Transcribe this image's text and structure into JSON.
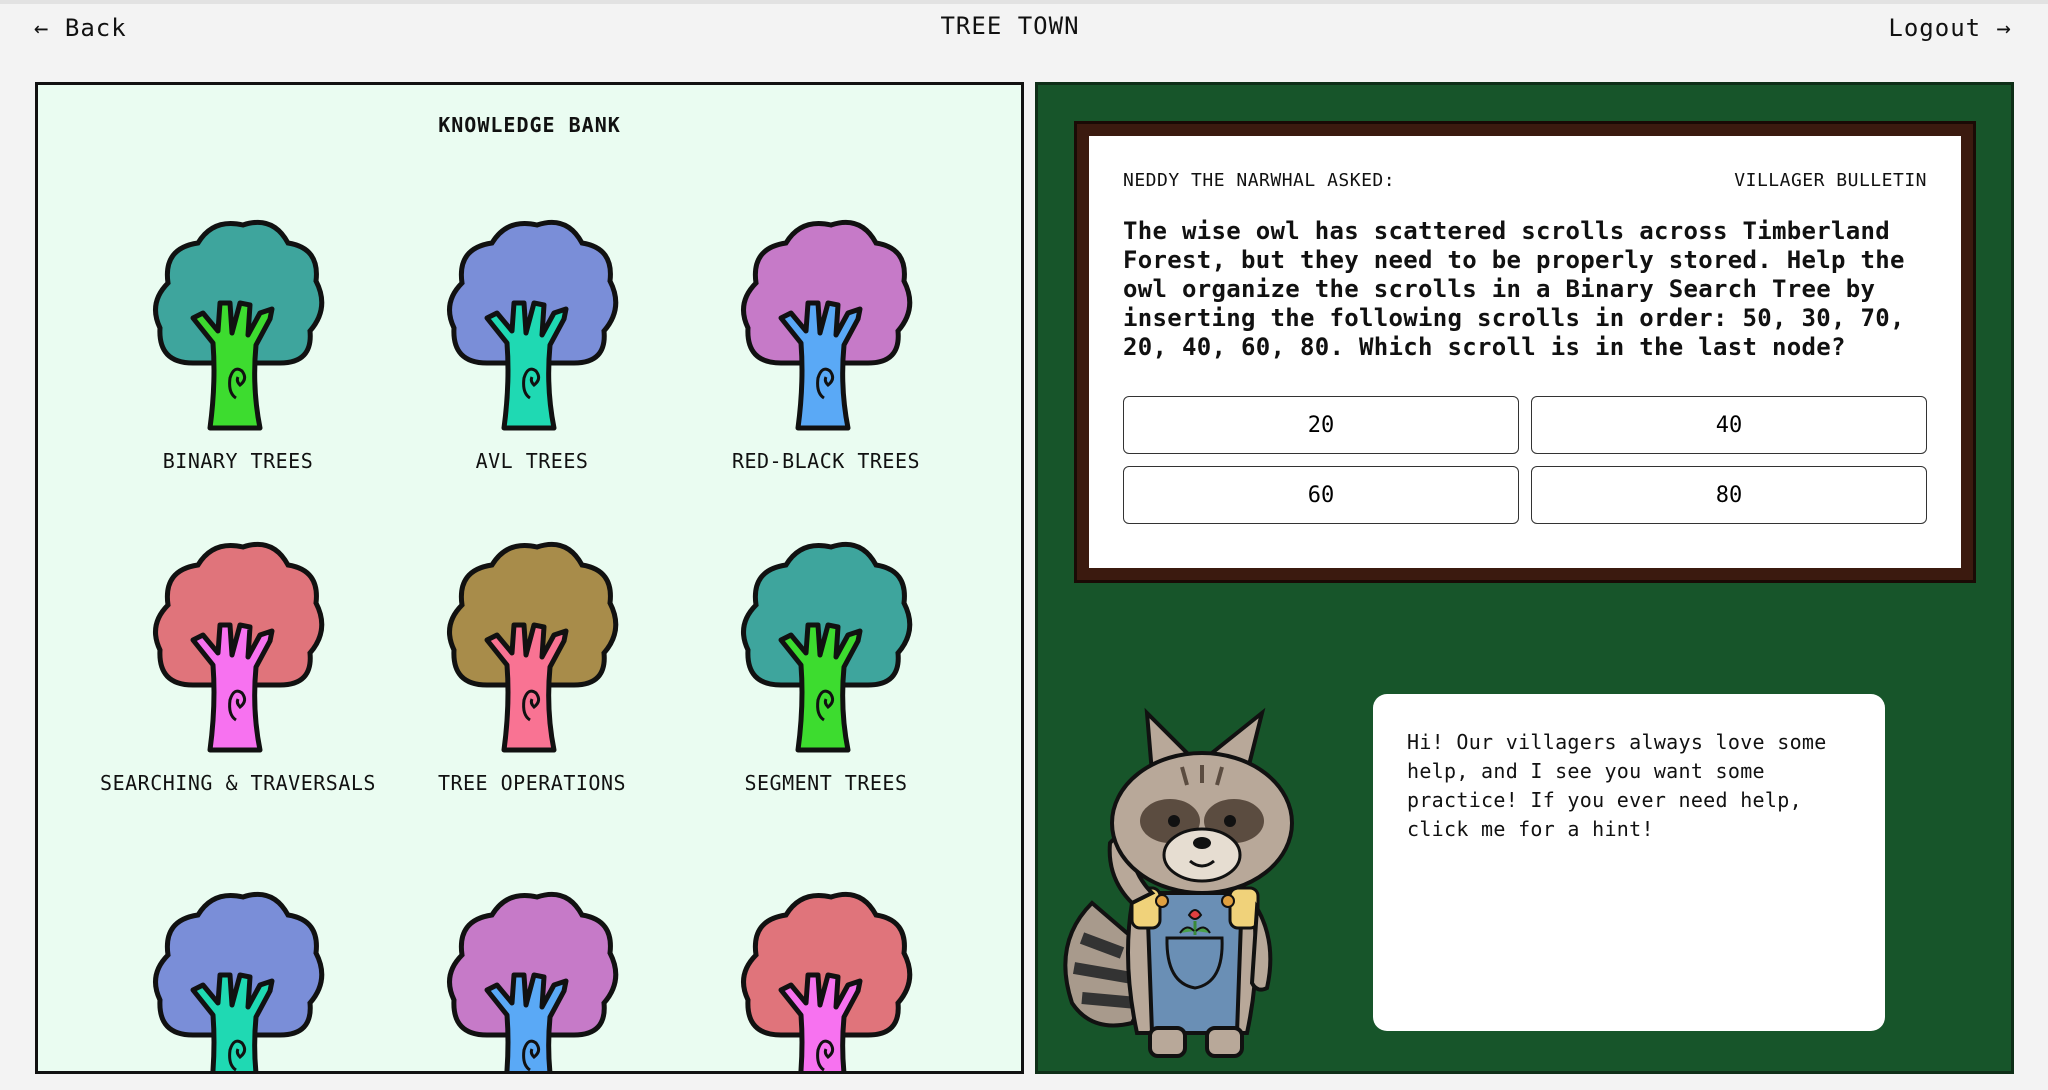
{
  "header": {
    "back_label": "← Back",
    "title": "TREE TOWN",
    "logout_label": "Logout →"
  },
  "knowledge_bank": {
    "title": "KNOWLEDGE BANK",
    "trees": [
      {
        "label": "BINARY TREES",
        "crown": "#3ea59d",
        "trunk": "#3ddc2f"
      },
      {
        "label": "AVL TREES",
        "crown": "#7a8ed8",
        "trunk": "#1fd9b3"
      },
      {
        "label": "RED-BLACK TREES",
        "crown": "#c67ac8",
        "trunk": "#5aa9f6"
      },
      {
        "label": "SEARCHING & TRAVERSALS",
        "crown": "#e0747b",
        "trunk": "#f772f0"
      },
      {
        "label": "TREE OPERATIONS",
        "crown": "#a88c4a",
        "trunk": "#f97393"
      },
      {
        "label": "SEGMENT TREES",
        "crown": "#3ea59d",
        "trunk": "#3ddc2f"
      },
      {
        "label": "",
        "crown": "#7a8ed8",
        "trunk": "#1fd9b3"
      },
      {
        "label": "",
        "crown": "#c67ac8",
        "trunk": "#5aa9f6"
      },
      {
        "label": "",
        "crown": "#e0747b",
        "trunk": "#f772f0"
      }
    ]
  },
  "bulletin": {
    "asker": "NEDDY THE NARWHAL ASKED:",
    "board_name": "VILLAGER BULLETIN",
    "question": "The wise owl has scattered scrolls across Timberland Forest, but they need to be properly stored. Help the owl organize the scrolls in a Binary Search Tree by inserting the following scrolls in order: 50, 30, 70, 20, 40, 60, 80. Which scroll is in the last node?",
    "answers": [
      "20",
      "40",
      "60",
      "80"
    ]
  },
  "helper": {
    "speech": "Hi! Our villagers always love some help, and I see you want some practice! If you ever need help, click me for a hint!"
  },
  "colors": {
    "page_bg": "#f3f3f3",
    "bank_bg": "#eafcf1",
    "board_bg": "#17552a",
    "frame": "#3b1a0f"
  }
}
